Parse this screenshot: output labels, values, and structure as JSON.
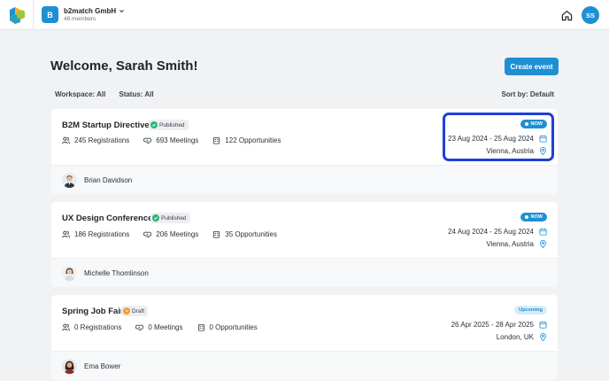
{
  "org": {
    "initial": "B",
    "name": "b2match GmbH",
    "members": "48 members"
  },
  "user": {
    "initials": "SS"
  },
  "header": {
    "welcome": "Welcome, Sarah Smith!",
    "create_label": "Create event"
  },
  "filters": {
    "workspace": "Workspace: All",
    "status": "Status: All",
    "sort": "Sort by: Default"
  },
  "colors": {
    "accent": "#1f8fd3",
    "published": "#2bb673",
    "draft": "#f0a030",
    "highlight": "#1d3fd8"
  },
  "events": [
    {
      "title": "B2M Startup Directive",
      "state": "Published",
      "registrations": "245 Registrations",
      "meetings": "693 Meetings",
      "opportunities": "122 Opportunities",
      "status": "NOW",
      "dates": "23 Aug 2024 - 25 Aug 2024",
      "location": "Vienna, Austria",
      "contact": "Brian Davidson"
    },
    {
      "title": "UX Design Conference",
      "state": "Published",
      "registrations": "186 Registrations",
      "meetings": "206 Meetings",
      "opportunities": "35 Opportunities",
      "status": "NOW",
      "dates": "24 Aug 2024 - 25 Aug 2024",
      "location": "Vienna, Austria",
      "contact": "Michelle Thomlinson"
    },
    {
      "title": "Spring Job Fair",
      "state": "Draft",
      "registrations": "0 Registrations",
      "meetings": "0 Meetings",
      "opportunities": "0 Opportunities",
      "status": "Upcoming",
      "dates": "26 Apr 2025 - 28 Apr 2025",
      "location": "London, UK",
      "contact": "Ema Bower"
    }
  ]
}
